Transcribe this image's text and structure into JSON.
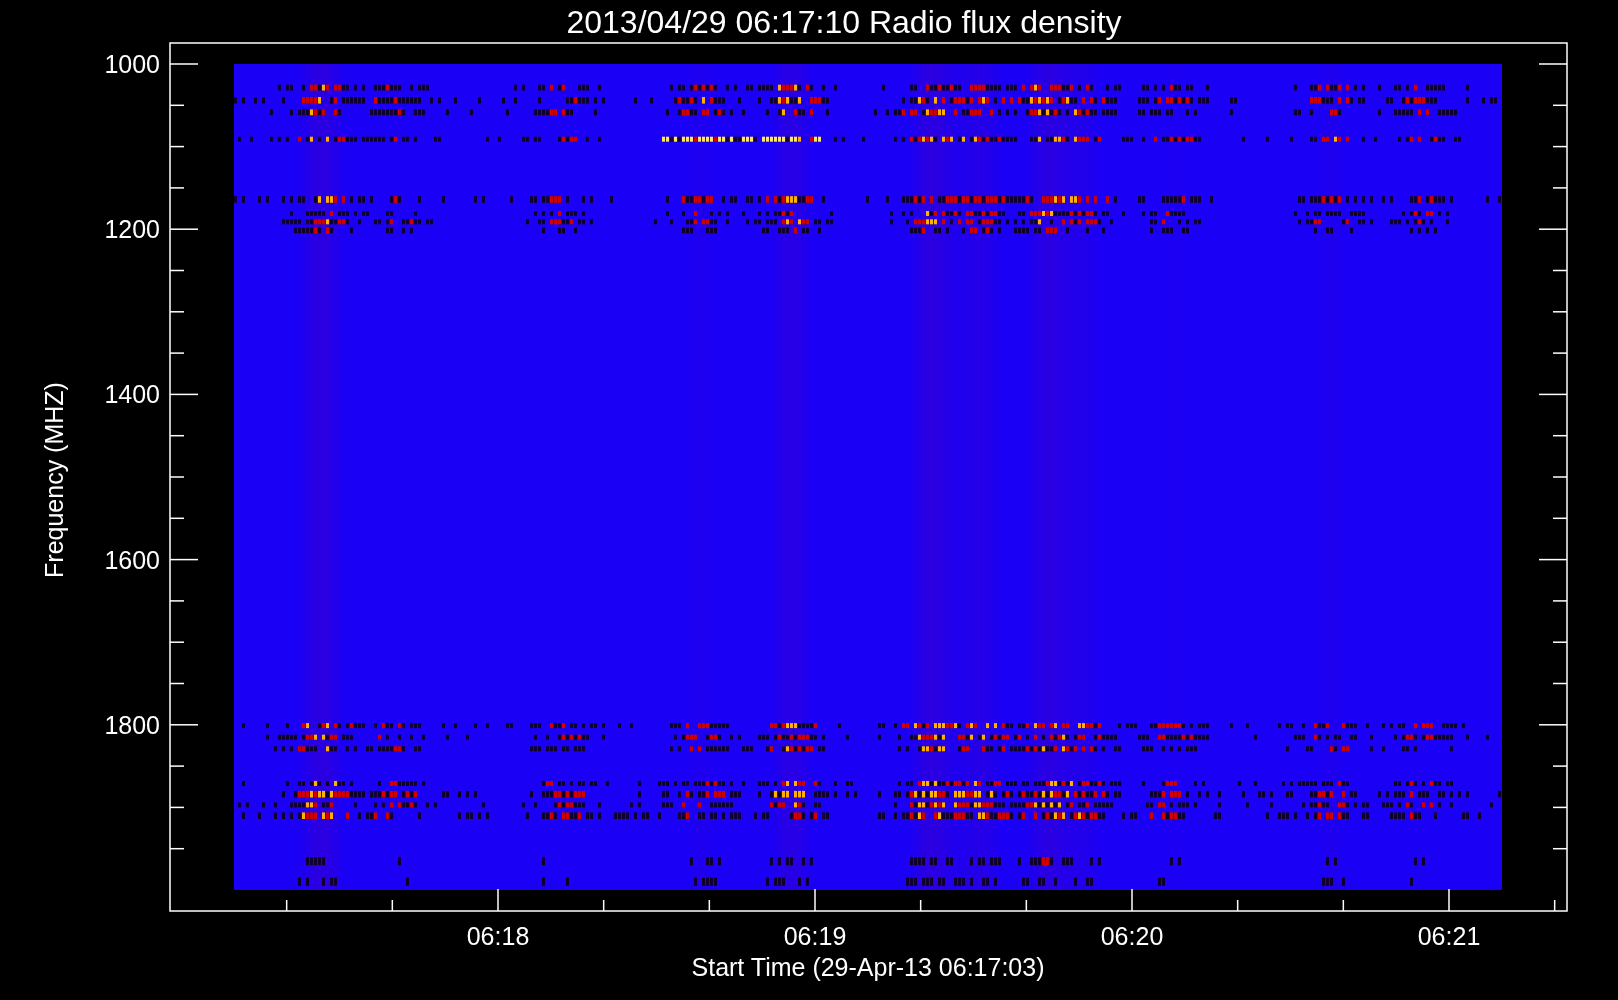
{
  "title": "2013/04/29 06:17:10 Radio flux density",
  "y_axis": {
    "label": "Frequency (MHZ)",
    "ticks": [
      "1000",
      "1200",
      "1400",
      "1600",
      "1800"
    ]
  },
  "x_axis": {
    "label": "Start Time (29-Apr-13 06:17:03)",
    "ticks": [
      "06:18",
      "06:19",
      "06:20",
      "06:21"
    ]
  }
}
